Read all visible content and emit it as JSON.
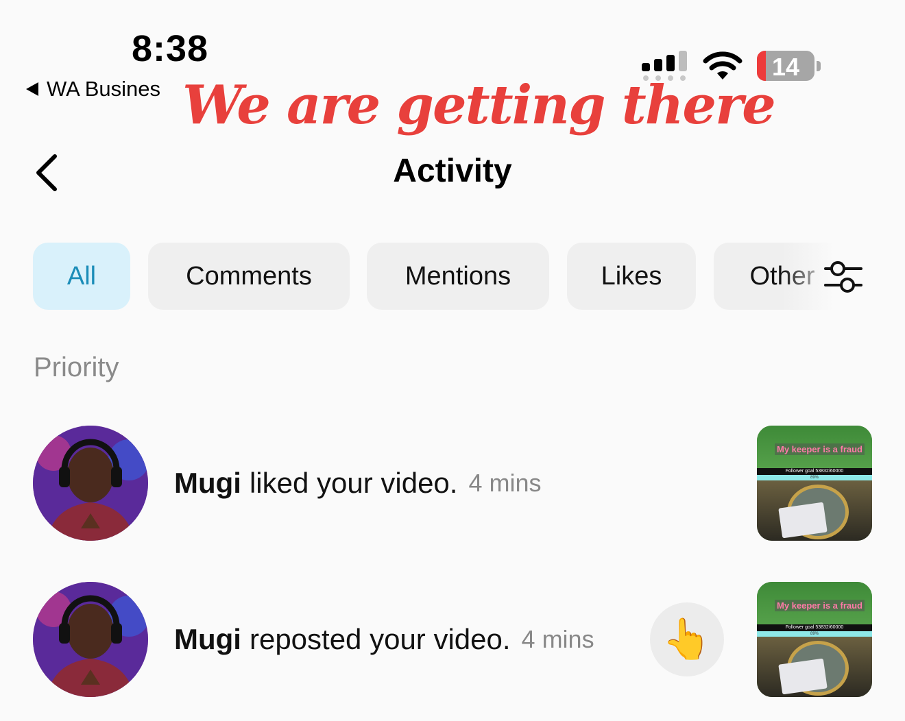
{
  "status_bar": {
    "time": "8:38",
    "back_app_label": "WA Busines",
    "battery_level": "14",
    "battery_color": "#ee3b3b"
  },
  "overlay": {
    "text": "We are getting there",
    "color": "#e8403c"
  },
  "header": {
    "title": "Activity",
    "back_icon": "chevron-left-icon"
  },
  "tabs": [
    {
      "label": "All",
      "active": true
    },
    {
      "label": "Comments",
      "active": false
    },
    {
      "label": "Mentions",
      "active": false
    },
    {
      "label": "Likes",
      "active": false
    },
    {
      "label": "Other",
      "active": false
    }
  ],
  "filter_icon": "sliders-icon",
  "section": {
    "label": "Priority"
  },
  "notifications": [
    {
      "user": "Mugi",
      "action": "liked your video.",
      "time": "4 mins",
      "thumb_caption": "My keeper is a fraud",
      "thumb_goal": "Follower goal 53832/60000",
      "thumb_progress": "89%"
    },
    {
      "user": "Mugi",
      "action": "reposted your video.",
      "time": "4 mins",
      "wave_icon": "👆",
      "thumb_caption": "My keeper is a fraud",
      "thumb_goal": "Follower goal 53832/60000",
      "thumb_progress": "89%"
    }
  ],
  "colors": {
    "accent": "#1b8db8",
    "active_tab_bg": "#d9f1fb",
    "tab_bg": "#efefef",
    "muted": "#888888"
  }
}
